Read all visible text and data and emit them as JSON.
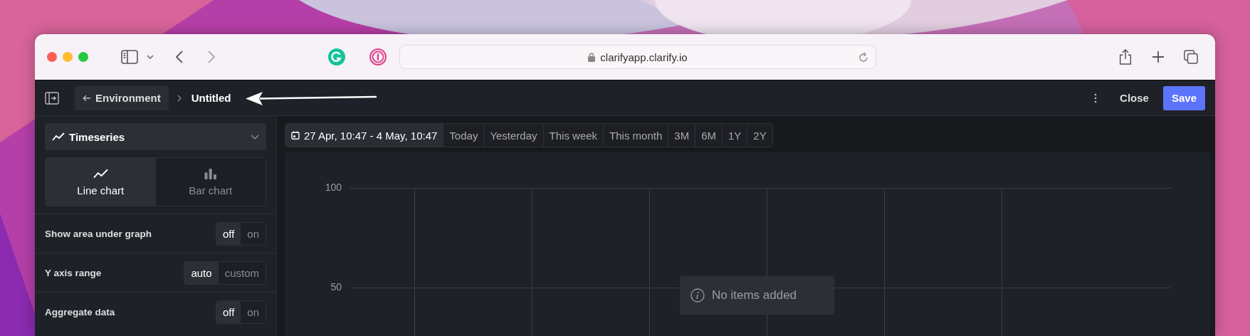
{
  "browser": {
    "url": "clarifyapp.clarify.io"
  },
  "header": {
    "back": "Environment",
    "title": "Untitled",
    "buttons": [
      {
        "label": "Close",
        "kind": "secondary"
      },
      {
        "label": "Save",
        "kind": "primary"
      }
    ]
  },
  "sidebar": {
    "visualization": "Timeseries",
    "chart_types": [
      {
        "label": "Line chart",
        "kind": "line",
        "selected": true
      },
      {
        "label": "Bar chart",
        "kind": "bar",
        "selected": false
      }
    ],
    "settings": [
      {
        "label": "Show area under graph",
        "options": [
          {
            "label": "off",
            "selected": true
          },
          {
            "label": "on",
            "selected": false
          }
        ]
      },
      {
        "label": "Y axis range",
        "options": [
          {
            "label": "auto",
            "selected": true
          },
          {
            "label": "custom",
            "selected": false
          }
        ]
      },
      {
        "label": "Aggregate data",
        "options": [
          {
            "label": "off",
            "selected": true
          },
          {
            "label": "on",
            "selected": false
          }
        ]
      }
    ]
  },
  "time_range": {
    "current": "27 Apr, 10:47 - 4 May, 10:47",
    "presets": [
      "Today",
      "Yesterday",
      "This week",
      "This month",
      "3M",
      "6M",
      "1Y",
      "2Y"
    ]
  },
  "chart": {
    "y_labels": [
      "100",
      "50"
    ],
    "message": "No items added"
  }
}
